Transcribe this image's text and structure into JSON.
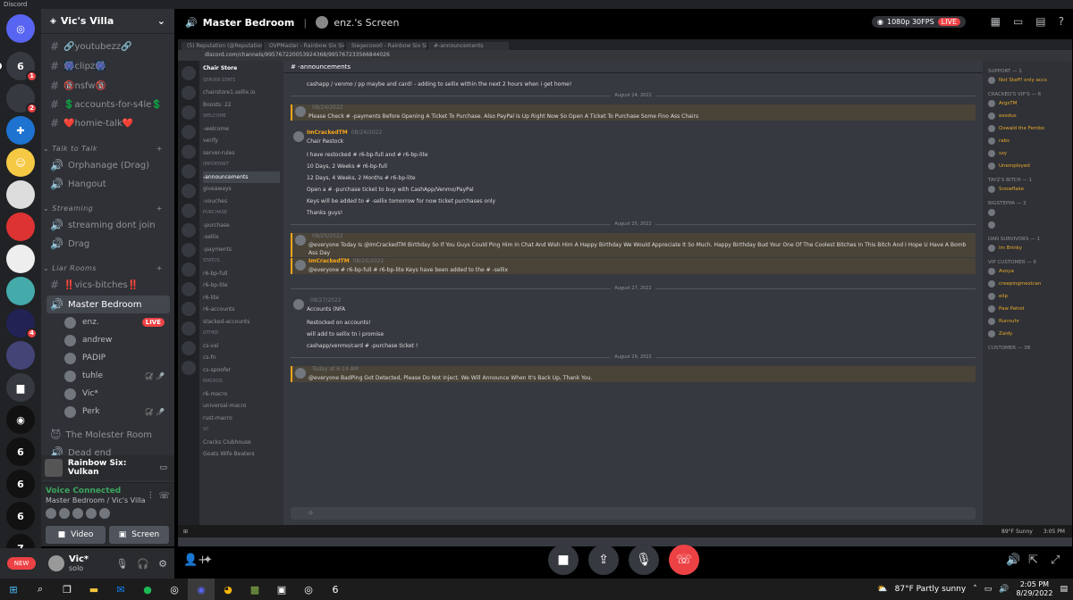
{
  "app_title": "Discord",
  "server": {
    "name": "Vic's Villa"
  },
  "channels": [
    {
      "type": "text",
      "label": "🔗youtubezz🔗"
    },
    {
      "type": "text",
      "label": "🎆clipz🎆"
    },
    {
      "type": "text",
      "label": "🔞nsfw🔞"
    },
    {
      "type": "text",
      "label": "💲accounts-for-s4le💲"
    },
    {
      "type": "text",
      "label": "❤️homie-talk❤️"
    }
  ],
  "categories": {
    "talk": "Talk to Talk",
    "streaming": "Streaming",
    "liar": "Liar Rooms"
  },
  "voice_channels": {
    "talk": [
      {
        "label": "Orphanage (Drag)"
      },
      {
        "label": "Hangout"
      }
    ],
    "streaming": [
      {
        "label": "streaming dont join"
      },
      {
        "label": "Drag"
      }
    ],
    "liar": [
      {
        "label": "‼️vics-bitches‼️"
      },
      {
        "label": "Master Bedroom"
      }
    ],
    "after": [
      {
        "label": "The Molester Room"
      },
      {
        "label": "Dead end"
      }
    ]
  },
  "voice_users": [
    {
      "name": "enz.",
      "live": "LIVE"
    },
    {
      "name": "andrew"
    },
    {
      "name": "PADIP"
    },
    {
      "name": "tuhle"
    },
    {
      "name": "Vic*"
    },
    {
      "name": "Perk"
    }
  ],
  "guild_badges": {
    "g1": "1",
    "g2": "2",
    "g3": "4",
    "new": "NEW"
  },
  "activity": {
    "game": "Rainbow Six: Vulkan"
  },
  "voice_panel": {
    "status": "Voice Connected",
    "location": "Master Bedroom / Vic's Villa",
    "video": "Video",
    "screen": "Screen"
  },
  "user": {
    "name": "Vic*",
    "status": "solo"
  },
  "stage": {
    "channel": "Master Bedroom",
    "stream_name": "enz.'s Screen",
    "quality": "1080p 30FPS",
    "live": "LIVE"
  },
  "inner": {
    "tabs": [
      "(5) Reputation (@ReputationV...",
      "OVPMaster - Rainbow Six Siege",
      "Siegecooo0 - Rainbow Six Siege",
      "#-announcements"
    ],
    "url": "discord.com/channels/995767220053924368/995767233566844026",
    "server": "Chair Store",
    "channel_title": "-announcements",
    "channels": [
      {
        "cat": true,
        "label": "SERVER STATS"
      },
      {
        "label": "chairstore1.sellix.io"
      },
      {
        "label": "Boosts: 22"
      },
      {
        "cat": true,
        "label": "WELCOME"
      },
      {
        "label": "-welcome"
      },
      {
        "label": "verify"
      },
      {
        "label": "server-rules"
      },
      {
        "cat": true,
        "label": "IMPORTANT"
      },
      {
        "label": "-announcements",
        "active": true
      },
      {
        "label": "giveaways"
      },
      {
        "label": "-vouches"
      },
      {
        "cat": true,
        "label": "PURCHASE"
      },
      {
        "label": "-purchase"
      },
      {
        "label": "-sellix"
      },
      {
        "label": "-payments"
      },
      {
        "cat": true,
        "label": "STATUS"
      },
      {
        "label": "r6-bp-full"
      },
      {
        "label": "r6-bp-lite"
      },
      {
        "label": "r6-lite"
      },
      {
        "label": "r6-accounts"
      },
      {
        "label": "stacked-accounts"
      },
      {
        "cat": true,
        "label": "OTHER"
      },
      {
        "label": "cs-val"
      },
      {
        "label": "cs-fn"
      },
      {
        "label": "cs-spoofer"
      },
      {
        "cat": true,
        "label": "MACROS"
      },
      {
        "label": "r6-macro"
      },
      {
        "label": "universal-macro"
      },
      {
        "label": "rust-macro"
      },
      {
        "cat": true,
        "label": "VC"
      },
      {
        "label": "Cracks Clubhouse"
      },
      {
        "label": "Goats Wife Beaters"
      }
    ],
    "messages": [
      {
        "body": "cashapp / venmo / pp maybe and card! - adding to sellix within the next 2 hours when i get home!"
      },
      {
        "date": "August 24, 2022"
      },
      {
        "name": "",
        "time": "08/24/2022",
        "hl": true,
        "body": "Please Check # -payments Before Opening A Ticket To Purchase. Also PayPal Is Up Right Now So Open A Ticket To Purchase Some Fino Ass Chairs"
      },
      {
        "name": "ImCrackedTM",
        "time": "08/24/2022",
        "body": "Chair Restock"
      },
      {
        "body": "I have restocked # r6-bp-full and # r6-bp-lite"
      },
      {
        "body": "10 Days, 2 Weeks # r6-bp-full"
      },
      {
        "body": "12 Days, 4 Weeks, 2 Months # r6-bp-lite"
      },
      {
        "body": "Open a # -purchase ticket to buy with CashApp/Venmo/PayPal"
      },
      {
        "body": "Keys will be added to # -sellix tomorrow for now ticket purchases only"
      },
      {
        "body": "Thanks guys!"
      },
      {
        "date": "August 25, 2022"
      },
      {
        "name": "",
        "time": "08/25/2022",
        "hl": true,
        "body": "@everyone Today Is @ImCrackedTM Birthday So If You Guys Could Ping Him In Chat And Wish Him A Happy Birthday We Would Appreciate It So Much.  Happy Birthday Bud Your One Of The Coolest Bitches In This Bitch And I Hope U Have A Bomb Ass Day"
      },
      {
        "name": "ImCrackedTM",
        "time": "08/25/2022",
        "hl": true,
        "body": "@everyone # r6-bp-full # r6-bp-lite Keys have been added to the # -sellix"
      },
      {
        "date": "August 27, 2022"
      },
      {
        "name": "",
        "time": "08/27/2022",
        "body": "Accounts (NFA"
      },
      {
        "body": "Restocked on accounts!"
      },
      {
        "body": "will add to sellix tn i promise"
      },
      {
        "body": "cashapp/venmo/card # -purchase ticket !"
      },
      {
        "date": "August 29, 2022"
      },
      {
        "name": "",
        "time": "Today at 6:14 AM",
        "hl": true,
        "body": "@everyone BadPing Got Detected, Please Do Not Inject. We Will Announce When It's Back Up, Thank You."
      }
    ],
    "members": [
      {
        "cat": "SUPPORT — 1"
      },
      {
        "name": "Not Staff! only accs"
      },
      {
        "cat": "CRACKED'S VIP'S — 6"
      },
      {
        "name": "ArgsTM"
      },
      {
        "name": "exodus"
      },
      {
        "name": "Oswald the Fembo"
      },
      {
        "name": "rabs"
      },
      {
        "name": "szy"
      },
      {
        "name": "Unemployed"
      },
      {
        "cat": "TAYZ'S BITCH — 1"
      },
      {
        "name": "Snowflake"
      },
      {
        "cat": "BIGSTEPPA — 3"
      },
      {
        "name": ""
      },
      {
        "name": ""
      },
      {
        "cat": "DAN SURVIVORS — 1"
      },
      {
        "name": "Im Brinky"
      },
      {
        "cat": "VIP CUSTOMER — 6"
      },
      {
        "name": "Axoya"
      },
      {
        "name": "creepingmexican"
      },
      {
        "name": "elip"
      },
      {
        "name": "Paw Patrol"
      },
      {
        "name": "Runnuhr"
      },
      {
        "name": "Zaidy"
      },
      {
        "cat": "CUSTOMER — 38"
      }
    ],
    "weather": "89°F Sunny",
    "time": "3:05 PM"
  },
  "taskbar": {
    "weather": "87°F  Partly sunny",
    "time": "2:05 PM",
    "date": "8/29/2022"
  }
}
